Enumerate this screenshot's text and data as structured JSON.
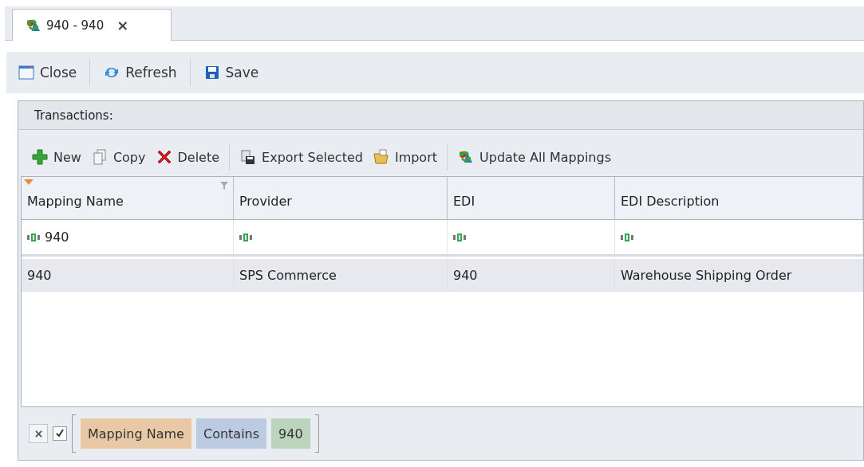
{
  "tabs": [
    {
      "label": "940 - 940",
      "close": "×",
      "selected": true
    }
  ],
  "toolbar": [
    {
      "label": "Close",
      "kind": "window"
    },
    {
      "label": "Refresh",
      "kind": "refresh"
    },
    {
      "label": "Save",
      "kind": "save"
    }
  ],
  "panel": {
    "title": "Transactions:",
    "toolbar_groups": [
      [
        {
          "label": "New",
          "kind": "plus"
        },
        {
          "label": "Copy",
          "kind": "copy"
        },
        {
          "label": "Delete",
          "kind": "delete"
        }
      ],
      [
        {
          "label": "Export Selected",
          "kind": "export"
        },
        {
          "label": "Import",
          "kind": "folder"
        }
      ],
      [
        {
          "label": "Update All Mappings",
          "kind": "sync"
        }
      ]
    ],
    "table": {
      "columns": [
        {
          "label": "Mapping Name",
          "filtered": true,
          "filter_value": "940"
        },
        {
          "label": "Provider",
          "filtered": false
        },
        {
          "label": "EDI",
          "filtered": false
        },
        {
          "label": "EDI Description",
          "filtered": false
        }
      ],
      "rows": [
        {
          "cells": [
            "940",
            "SPS Commerce",
            "940",
            "Warehouse Shipping Order"
          ],
          "selected": true
        }
      ]
    },
    "filter_bar": {
      "enabled": true,
      "field": "Mapping Name",
      "operator": "Contains",
      "value": "940"
    }
  }
}
